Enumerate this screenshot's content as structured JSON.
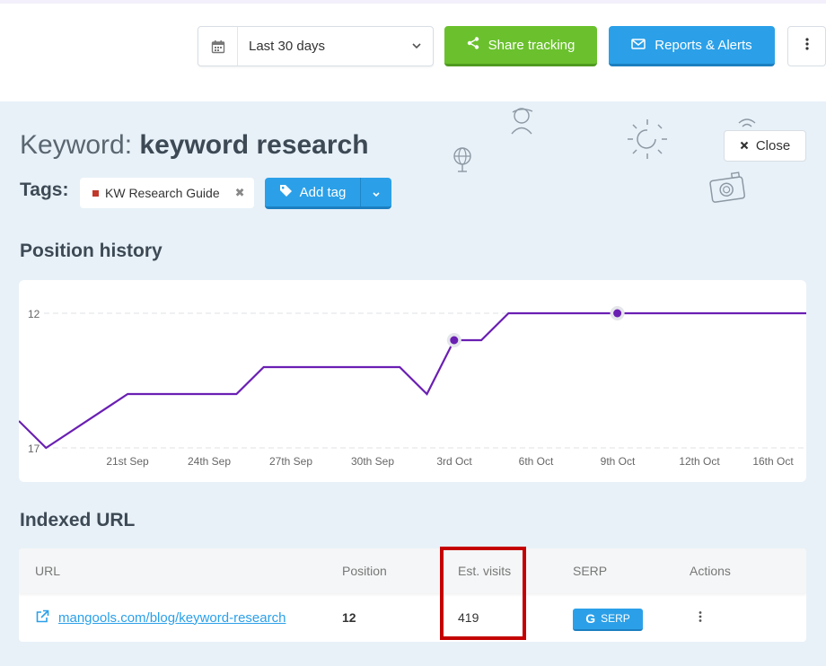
{
  "toolbar": {
    "date_range": "Last 30 days",
    "share_label": "Share tracking",
    "reports_label": "Reports & Alerts"
  },
  "header": {
    "keyword_prefix": "Keyword:",
    "keyword": "keyword research",
    "close_label": "Close"
  },
  "tags": {
    "label": "Tags:",
    "items": [
      {
        "name": "KW Research Guide",
        "color": "#c0392b"
      }
    ],
    "add_label": "Add tag"
  },
  "sections": {
    "position_history": "Position history",
    "indexed_url": "Indexed URL"
  },
  "chart_data": {
    "type": "line",
    "y_ticks": [
      "12",
      "17"
    ],
    "ylim": [
      17,
      12
    ],
    "y_inverted": true,
    "x_ticks": [
      "21st Sep",
      "24th Sep",
      "27th Sep",
      "30th Sep",
      "3rd Oct",
      "6th Oct",
      "9th Oct",
      "12th Oct",
      "16th Oct"
    ],
    "series": [
      {
        "color": "#6a1fb3",
        "points": [
          [
            "2023-09-17",
            16
          ],
          [
            "2023-09-18",
            17
          ],
          [
            "2023-09-21",
            15
          ],
          [
            "2023-09-25",
            15
          ],
          [
            "2023-09-26",
            14
          ],
          [
            "2023-10-01",
            14
          ],
          [
            "2023-10-02",
            15
          ],
          [
            "2023-10-03",
            13
          ],
          [
            "2023-10-04",
            13
          ],
          [
            "2023-10-05",
            12
          ],
          [
            "2023-10-17",
            12
          ]
        ],
        "markers": [
          [
            "2023-10-03",
            13
          ],
          [
            "2023-10-09",
            12
          ]
        ]
      }
    ]
  },
  "table": {
    "headers": {
      "url": "URL",
      "position": "Position",
      "est_visits": "Est. visits",
      "serp": "SERP",
      "actions": "Actions"
    },
    "rows": [
      {
        "url": "mangools.com/blog/keyword-research",
        "position": "12",
        "est_visits": "419",
        "serp_label": "SERP"
      }
    ]
  },
  "colors": {
    "green": "#6ac12d",
    "blue": "#2ba0e8",
    "line": "#6a1fb3",
    "highlight": "#c40000"
  }
}
